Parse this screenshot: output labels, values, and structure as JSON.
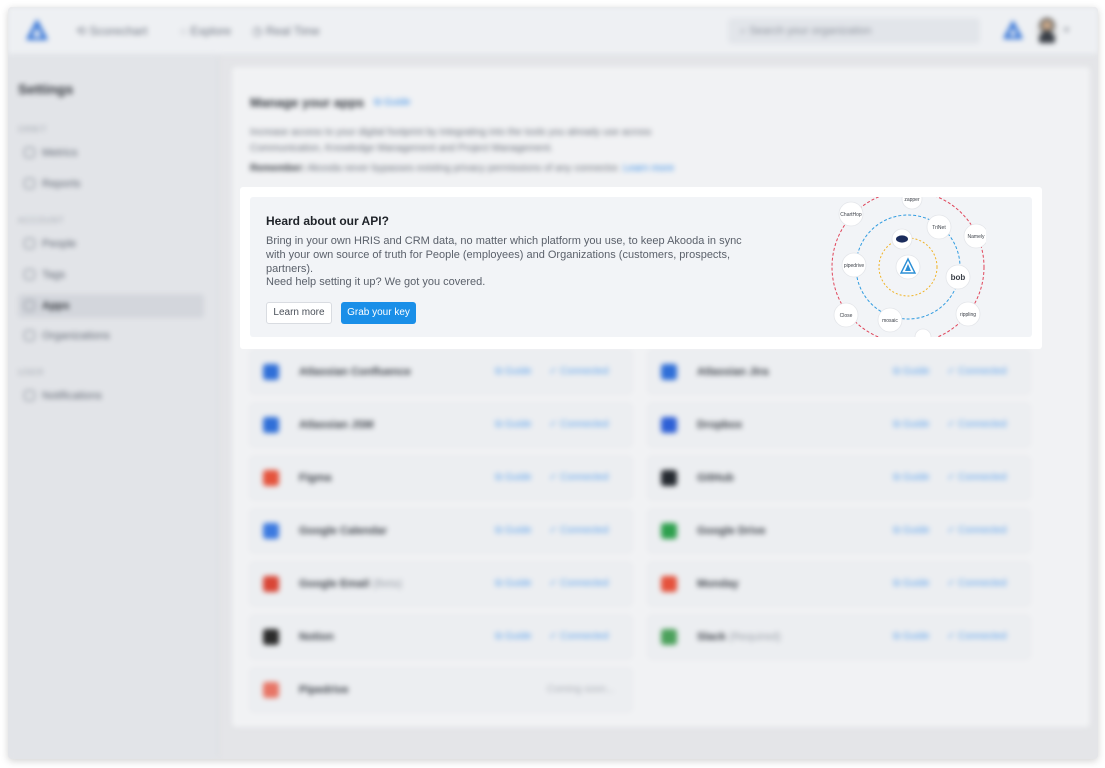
{
  "topbar": {
    "nav": [
      {
        "label": "Scorechart",
        "icon": "chart-icon"
      },
      {
        "label": "Explore",
        "icon": "compass-icon"
      },
      {
        "label": "Real Time",
        "icon": "clock-icon"
      }
    ],
    "search_placeholder": "Search your organization"
  },
  "sidebar": {
    "title": "Settings",
    "sections": [
      {
        "label": "ORBIT",
        "items": [
          {
            "label": "Metrics",
            "icon": "metrics-icon"
          },
          {
            "label": "Reports",
            "icon": "reports-icon"
          }
        ]
      },
      {
        "label": "ACCOUNT",
        "items": [
          {
            "label": "People",
            "icon": "people-icon"
          },
          {
            "label": "Tags",
            "icon": "tag-icon"
          },
          {
            "label": "Apps",
            "icon": "apps-icon",
            "active": true
          },
          {
            "label": "Organizations",
            "icon": "organizations-icon"
          }
        ]
      },
      {
        "label": "USER",
        "items": [
          {
            "label": "Notifications",
            "icon": "bell-icon"
          }
        ]
      }
    ]
  },
  "main": {
    "title": "Manage your apps",
    "guide_label": "Guide",
    "description": "Increase access to your digital footprint by integrating into the tools you already use across Communication, Knowledge Management and Project Management.",
    "reminder_label": "Remember:",
    "reminder_text": "Akooda never bypasses existing privacy permissions of any connector.",
    "reminder_link": "Learn more",
    "apps": [
      {
        "name": "Atlassian Confluence",
        "note": "",
        "guide": "Guide",
        "status": "Connected",
        "color": "#2f6fd8"
      },
      {
        "name": "Atlassian Jira",
        "note": "",
        "guide": "Guide",
        "status": "Connected",
        "color": "#2f6fd8"
      },
      {
        "name": "Atlassian JSM",
        "note": "",
        "guide": "Guide",
        "status": "Connected",
        "color": "#2f6fd8"
      },
      {
        "name": "Dropbox",
        "note": "",
        "guide": "Guide",
        "status": "Connected",
        "color": "#2d5fd6"
      },
      {
        "name": "Figma",
        "note": "",
        "guide": "Guide",
        "status": "Connected",
        "color": "#e5533c"
      },
      {
        "name": "GitHub",
        "note": "",
        "guide": "Guide",
        "status": "Connected",
        "color": "#24292f"
      },
      {
        "name": "Google Calendar",
        "note": "",
        "guide": "Guide",
        "status": "Connected",
        "color": "#3c7ae0"
      },
      {
        "name": "Google Drive",
        "note": "",
        "guide": "Guide",
        "status": "Connected",
        "color": "#2ea04e"
      },
      {
        "name": "Google Email",
        "note": "(Beta)",
        "guide": "Guide",
        "status": "Connected",
        "color": "#d94535"
      },
      {
        "name": "Monday",
        "note": "",
        "guide": "Guide",
        "status": "Connected",
        "color": "#e5523c"
      },
      {
        "name": "Notion",
        "note": "",
        "guide": "Guide",
        "status": "Connected",
        "color": "#2b2b2b"
      },
      {
        "name": "Slack",
        "note": "(Required)",
        "guide": "Guide",
        "status": "Connected",
        "color": "#4ca15b"
      },
      {
        "name": "Pipedrive",
        "note": "",
        "guide": "",
        "status": "Coming soon...",
        "color": "#e87565"
      }
    ]
  },
  "api_card": {
    "title": "Heard about our API?",
    "text": "Bring in your own HRIS and CRM data, no matter which platform you use, to keep Akooda in sync with your own source of truth for People (employees) and Organizations (customers, prospects, partners).",
    "help": "Need help setting it up? We got you covered.",
    "learn_more": "Learn more",
    "grab_key": "Grab your key",
    "partners": [
      "ChartHop",
      "TriNet",
      "Namely",
      "pipedrive",
      "bob",
      "rippling",
      "Close",
      "mosaic",
      "zapper"
    ]
  },
  "colors": {
    "accent": "#1a8fe8",
    "orbit_outer": "#e0455a",
    "orbit_middle": "#2f9be0",
    "orbit_inner": "#f0b429"
  }
}
